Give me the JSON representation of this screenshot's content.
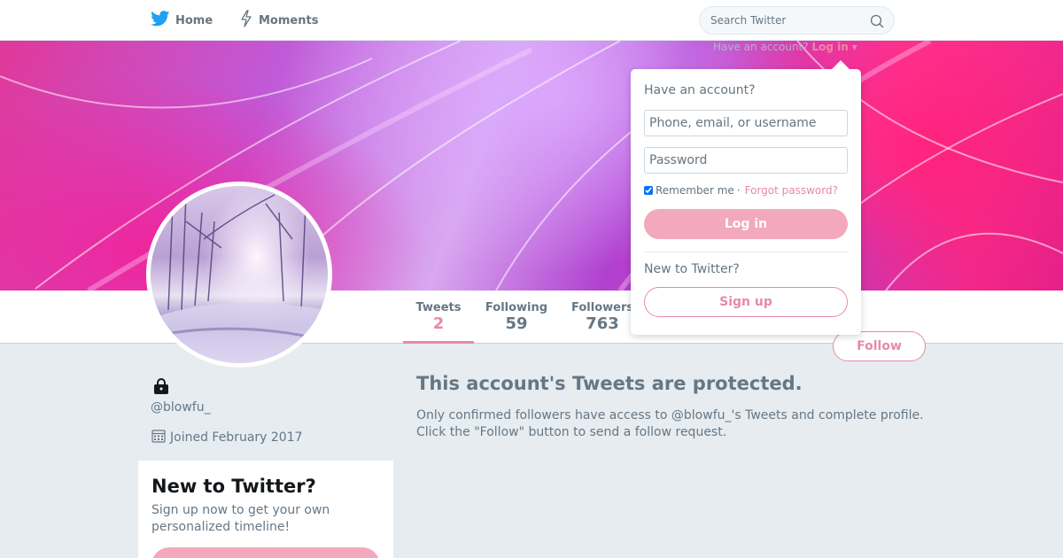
{
  "nav": {
    "home_label": "Home",
    "moments_label": "Moments",
    "search_placeholder": "Search Twitter"
  },
  "login_toggle": {
    "prompt": "Have an account?",
    "link": "Log in",
    "caret": "▾"
  },
  "stats": [
    {
      "label": "Tweets",
      "value": "2"
    },
    {
      "label": "Following",
      "value": "59"
    },
    {
      "label": "Followers",
      "value": "763"
    }
  ],
  "follow_label": "Follow",
  "profile": {
    "handle": "@blowfu_",
    "joined": "Joined February 2017"
  },
  "signup_card": {
    "title": "New to Twitter?",
    "text": "Sign up now to get your own personalized timeline!"
  },
  "protected": {
    "title": "This account's Tweets are protected.",
    "line1": "Only confirmed followers have access to @blowfu_'s Tweets and complete profile.",
    "line2": "Click the \"Follow\" button to send a follow request."
  },
  "login_dropdown": {
    "heading": "Have an account?",
    "username_placeholder": "Phone, email, or username",
    "password_placeholder": "Password",
    "remember": "Remember me",
    "separator": "·",
    "forgot": "Forgot password?",
    "login_button": "Log in",
    "new_prompt": "New to Twitter?",
    "signup_button": "Sign up"
  },
  "colors": {
    "accent": "#e88aa5",
    "accent_light": "#f3a8bd",
    "twitter_blue": "#1da1f2",
    "text_muted": "#657786",
    "page_bg": "#e6ecf0"
  },
  "icons": [
    "twitter-bird-icon",
    "lightning-icon",
    "search-icon",
    "lock-icon",
    "calendar-icon"
  ]
}
